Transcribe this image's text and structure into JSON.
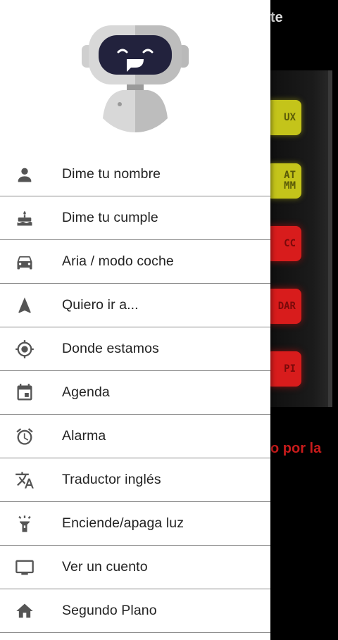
{
  "background": {
    "title_fragment": "te",
    "buttons": [
      {
        "label": "UX",
        "color": "yellow"
      },
      {
        "label": "AT\nMM",
        "color": "yellow"
      },
      {
        "label": "CC",
        "color": "red"
      },
      {
        "label": "DAR",
        "color": "red"
      },
      {
        "label": "PI",
        "color": "red"
      }
    ],
    "red_text": "o por la"
  },
  "menu": {
    "items": [
      {
        "label": "Dime tu nombre",
        "icon": "person-icon"
      },
      {
        "label": "Dime tu cumple",
        "icon": "cake-icon"
      },
      {
        "label": "Aria / modo coche",
        "icon": "car-icon"
      },
      {
        "label": "Quiero ir a...",
        "icon": "navigation-icon"
      },
      {
        "label": "Donde estamos",
        "icon": "gps-location-icon"
      },
      {
        "label": "Agenda",
        "icon": "calendar-icon"
      },
      {
        "label": "Alarma",
        "icon": "alarm-icon"
      },
      {
        "label": "Traductor inglés",
        "icon": "translate-icon"
      },
      {
        "label": "Enciende/apaga luz",
        "icon": "flashlight-icon"
      },
      {
        "label": "Ver un cuento",
        "icon": "monitor-icon"
      },
      {
        "label": "Segundo Plano",
        "icon": "home-icon"
      }
    ]
  }
}
